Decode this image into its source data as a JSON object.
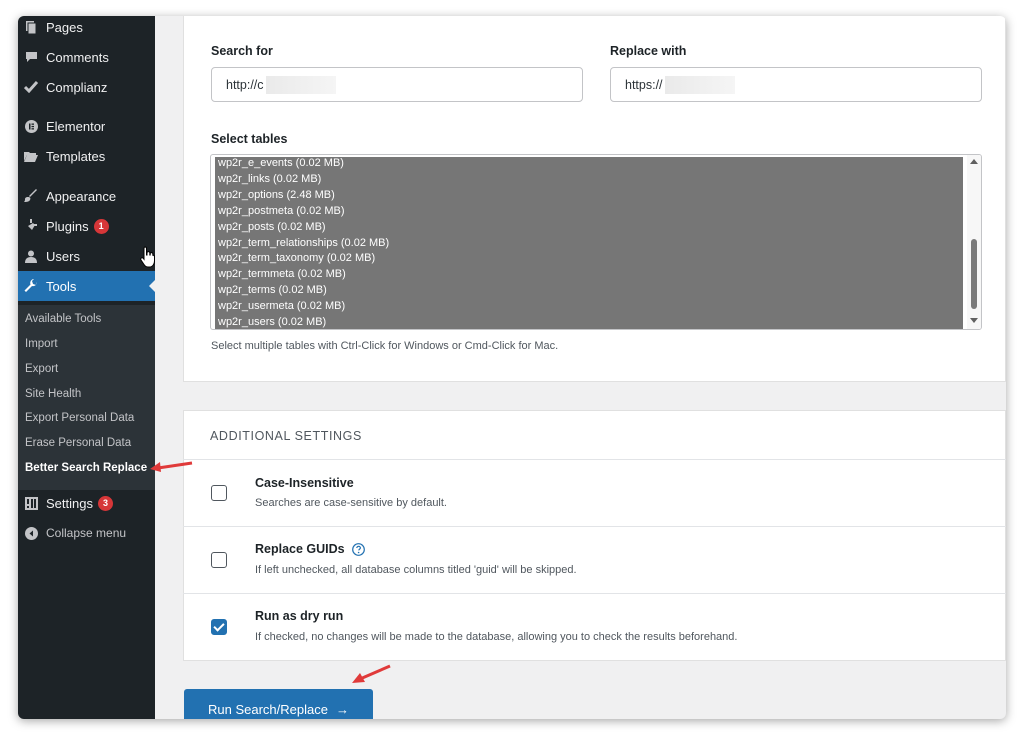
{
  "sidebar": {
    "items": [
      {
        "label": "Pages",
        "icon": "pages-icon"
      },
      {
        "label": "Comments",
        "icon": "comments-icon"
      },
      {
        "label": "Complianz",
        "icon": "checkmark-icon"
      },
      {
        "label": "Elementor",
        "icon": "elementor-icon"
      },
      {
        "label": "Templates",
        "icon": "folder-icon"
      },
      {
        "label": "Appearance",
        "icon": "paintbrush-icon"
      },
      {
        "label": "Plugins",
        "icon": "plugin-icon",
        "badge": "1"
      },
      {
        "label": "Users",
        "icon": "user-icon"
      },
      {
        "label": "Tools",
        "icon": "wrench-icon"
      },
      {
        "label": "Settings",
        "icon": "settings-icon",
        "badge": "3"
      },
      {
        "label": "Collapse menu",
        "icon": "collapse-icon"
      }
    ],
    "submenu": [
      "Available Tools",
      "Import",
      "Export",
      "Site Health",
      "Export Personal Data",
      "Erase Personal Data",
      "Better Search Replace"
    ]
  },
  "form": {
    "search_label": "Search for",
    "search_value": "http://c",
    "replace_label": "Replace with",
    "replace_value": "https://",
    "tables_label": "Select tables",
    "tables": [
      "wp2r_e_events (0.02 MB)",
      "wp2r_links (0.02 MB)",
      "wp2r_options (2.48 MB)",
      "wp2r_postmeta (0.02 MB)",
      "wp2r_posts (0.02 MB)",
      "wp2r_term_relationships (0.02 MB)",
      "wp2r_term_taxonomy (0.02 MB)",
      "wp2r_termmeta (0.02 MB)",
      "wp2r_terms (0.02 MB)",
      "wp2r_usermeta (0.02 MB)",
      "wp2r_users (0.02 MB)"
    ],
    "tables_hint": "Select multiple tables with Ctrl-Click for Windows or Cmd-Click for Mac."
  },
  "additional": {
    "title": "ADDITIONAL SETTINGS",
    "options": [
      {
        "title": "Case-Insensitive",
        "desc": "Searches are case-sensitive by default.",
        "checked": false
      },
      {
        "title": "Replace GUIDs",
        "desc": "If left unchecked, all database columns titled 'guid' will be skipped.",
        "checked": false
      },
      {
        "title": "Run as dry run",
        "desc": "If checked, no changes will be made to the database, allowing you to check the results beforehand.",
        "checked": true
      }
    ]
  },
  "run_button": {
    "label": "Run Search/Replace",
    "arrow": "→"
  },
  "colors": {
    "sidebar": "#1d2327",
    "accent": "#2271b1",
    "badge": "#d63638",
    "annotation": "#e03a3a"
  }
}
